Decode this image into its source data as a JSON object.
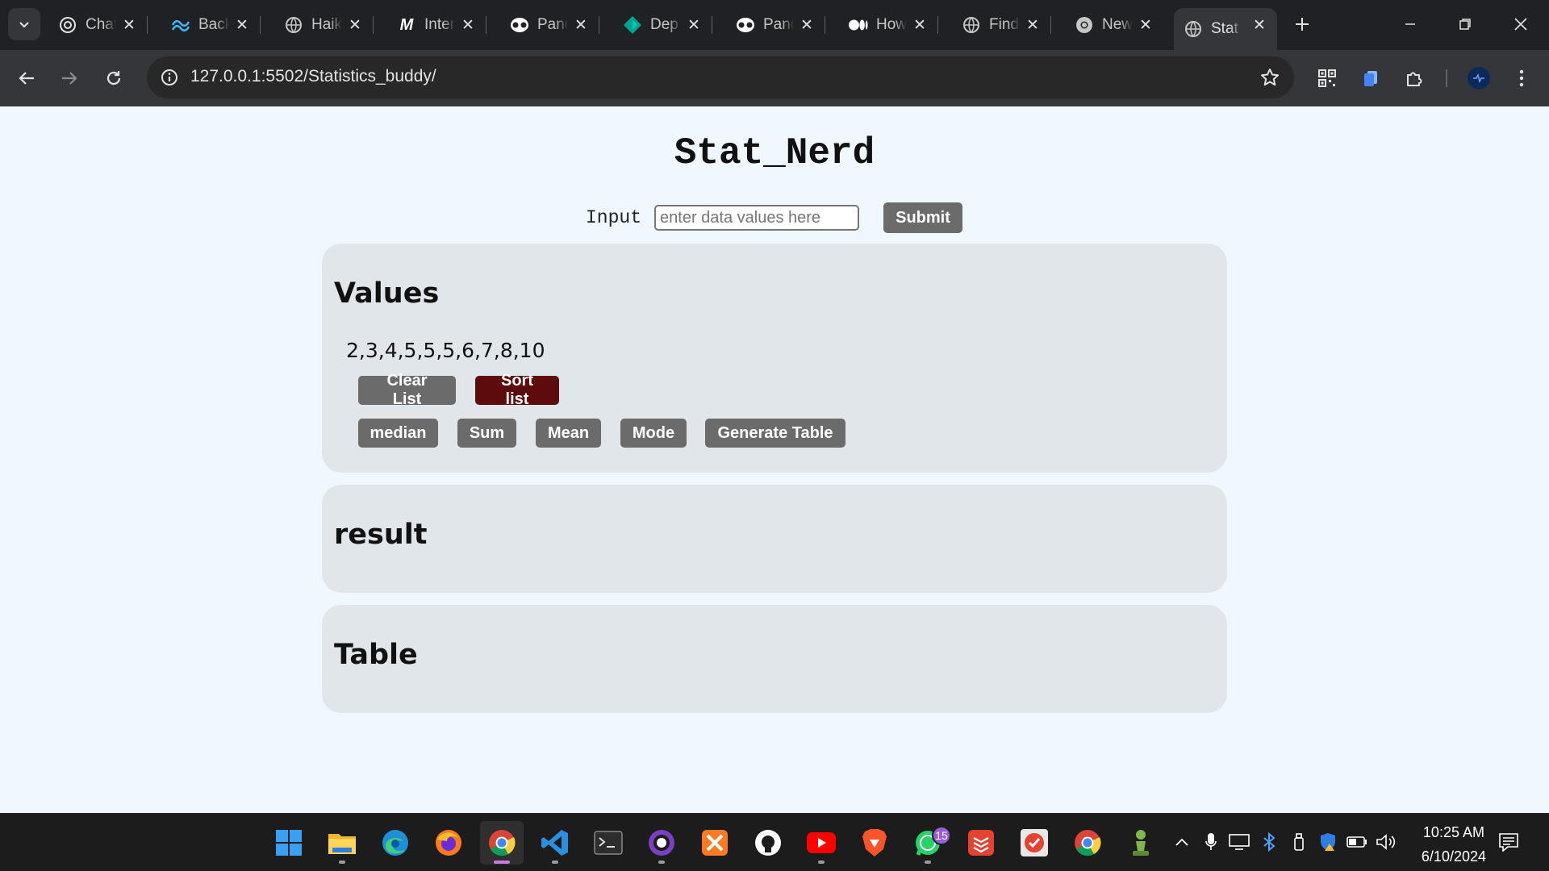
{
  "browser": {
    "tabs": [
      {
        "title": "Chat",
        "icon": "chatgpt-icon"
      },
      {
        "title": "Back",
        "icon": "tailwind-icon"
      },
      {
        "title": "Haik",
        "icon": "globe-icon"
      },
      {
        "title": "Inter",
        "icon": "m-logo-icon"
      },
      {
        "title": "Pand",
        "icon": "panda-icon"
      },
      {
        "title": "Dep",
        "icon": "diamond-icon"
      },
      {
        "title": "Pand",
        "icon": "panda-icon"
      },
      {
        "title": "How",
        "icon": "medium-icon"
      },
      {
        "title": "Find",
        "icon": "globe-icon"
      },
      {
        "title": "New",
        "icon": "chrome-icon"
      },
      {
        "title": "Stat",
        "icon": "globe-icon",
        "active": true
      }
    ],
    "url": "127.0.0.1:5502/Statistics_buddy/"
  },
  "app": {
    "title": "Stat_Nerd",
    "input_label": "Input",
    "input_placeholder": "enter data values here",
    "input_value": "",
    "submit_label": "Submit"
  },
  "values_card": {
    "heading": "Values",
    "values_text": "2,3,4,5,5,5,6,7,8,10",
    "clear_label": "Clear List",
    "sort_label": "Sort list",
    "median_label": "median",
    "sum_label": "Sum",
    "mean_label": "Mean",
    "mode_label": "Mode",
    "generate_label": "Generate Table"
  },
  "result_card": {
    "heading": "result"
  },
  "table_card": {
    "heading": "Table"
  },
  "taskbar": {
    "whatsapp_badge": "15",
    "time": "10:25 AM",
    "date": "6/10/2024"
  },
  "colors": {
    "page_bg": "#f0f8ff",
    "card_bg": "#e1e6ea",
    "button_gray": "#6b6b6b",
    "button_dark_red": "#5d0b0b"
  }
}
